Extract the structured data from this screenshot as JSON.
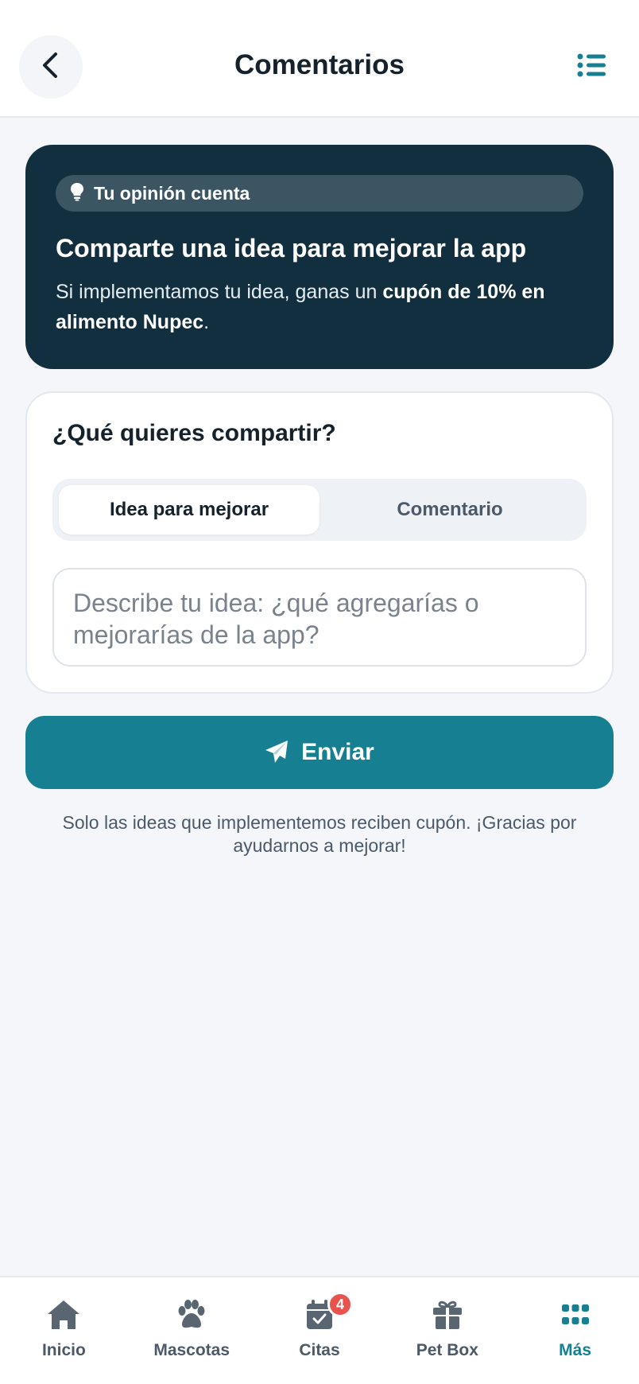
{
  "header": {
    "title": "Comentarios",
    "back_icon": "chevron-left-icon",
    "menu_icon": "list-icon"
  },
  "hero": {
    "chip_icon": "lightbulb-icon",
    "chip_label": "Tu opinión cuenta",
    "title": "Comparte una idea para mejorar la app",
    "text_before": "Si implementamos tu idea, ganas un ",
    "text_bold": "cupón de 10% en alimento Nupec",
    "text_after": "."
  },
  "form": {
    "heading": "¿Qué quieres compartir?",
    "tabs": [
      {
        "label": "Idea para mejorar",
        "selected": true
      },
      {
        "label": "Comentario",
        "selected": false
      }
    ],
    "textarea_value": "",
    "textarea_placeholder": "Describe tu idea: ¿qué agregarías o mejorarías de la app?"
  },
  "send": {
    "icon": "paper-plane-icon",
    "label": "Enviar"
  },
  "note": "Solo las ideas que implementemos reciben cupón. ¡Gracias por ayudarnos a mejorar!",
  "bottom_nav": {
    "items": [
      {
        "label": "Inicio",
        "icon": "home-icon",
        "active": false
      },
      {
        "label": "Mascotas",
        "icon": "paw-icon",
        "active": false
      },
      {
        "label": "Citas",
        "icon": "calendar-check-icon",
        "active": false,
        "badge": "4"
      },
      {
        "label": "Pet Box",
        "icon": "gift-icon",
        "active": false
      },
      {
        "label": "Más",
        "icon": "grid-icon",
        "active": true
      }
    ]
  },
  "colors": {
    "accent": "#167f91",
    "hero_bg": "#112f3e",
    "badge": "#e8534d",
    "page_bg": "#f4f6fa"
  }
}
